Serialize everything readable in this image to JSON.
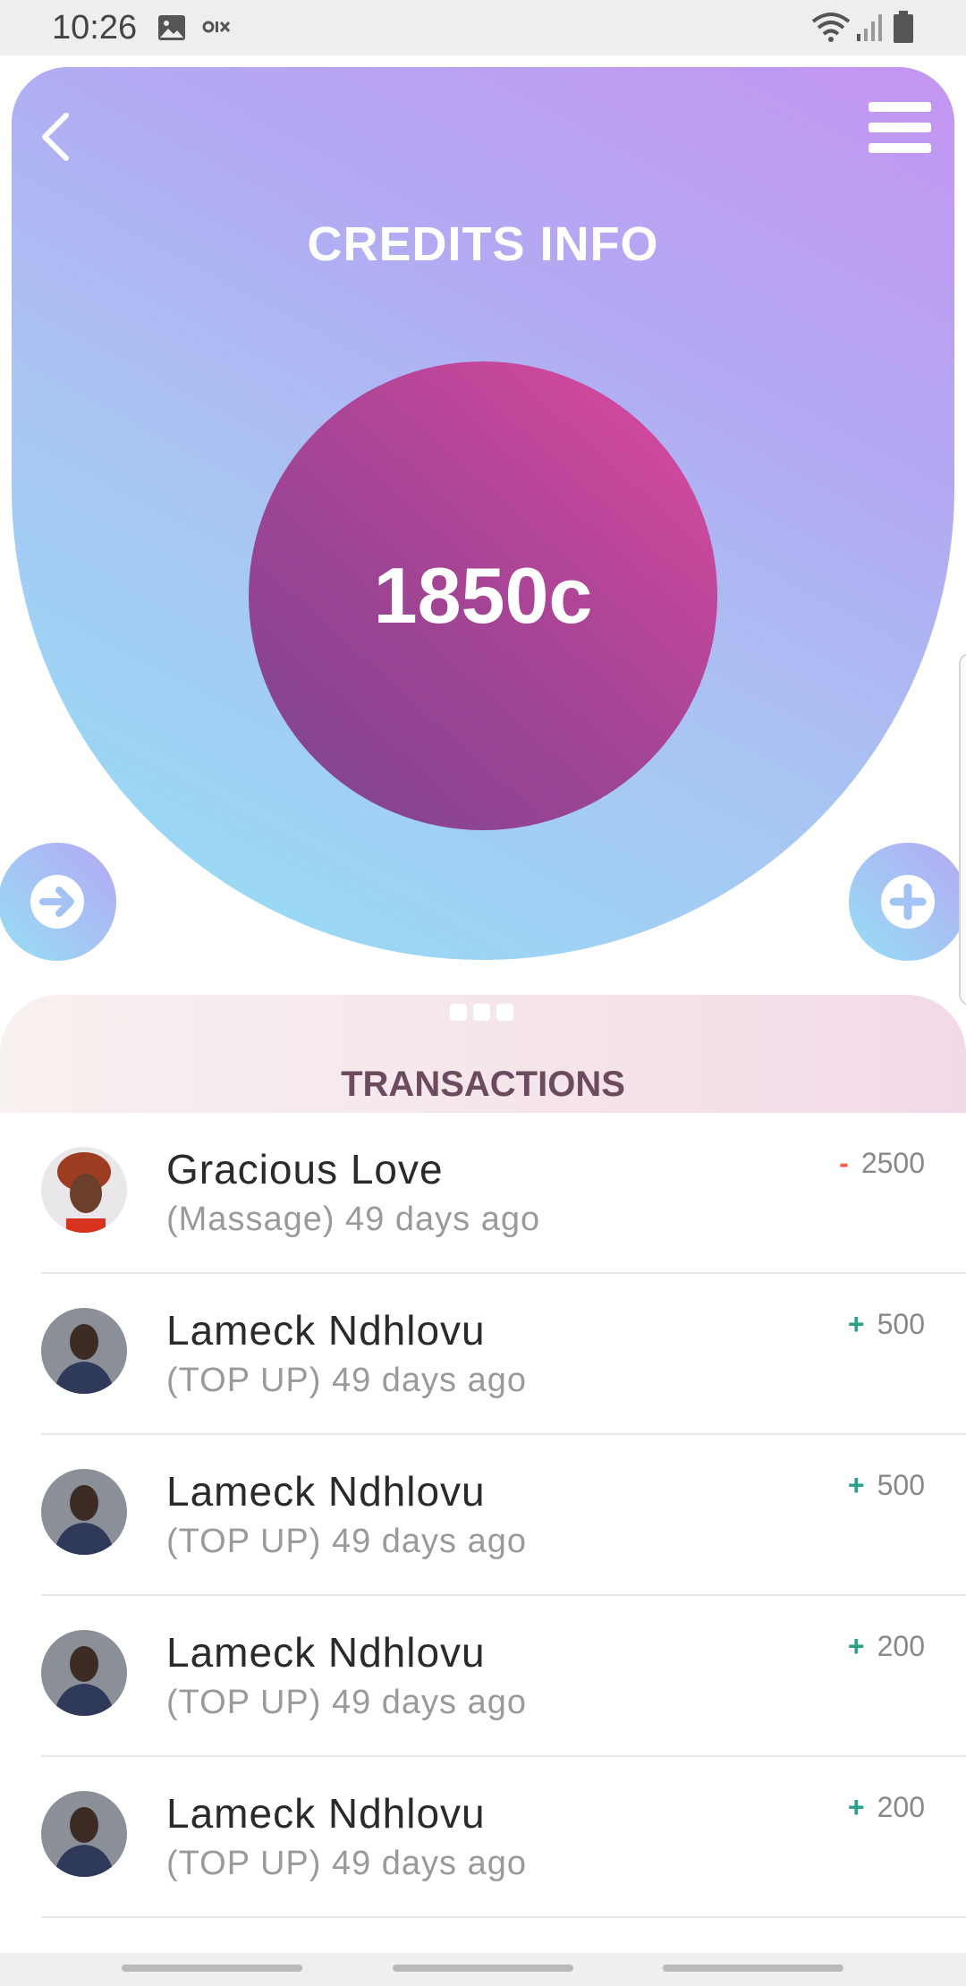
{
  "status_bar": {
    "time": "10:26",
    "icons": [
      "image-icon",
      "voicemail-icon",
      "wifi-icon",
      "signal-icon",
      "battery-icon"
    ]
  },
  "header": {
    "back_icon": "chevron-left-icon",
    "menu_icon": "hamburger-menu-icon",
    "title": "CREDITS INFO",
    "credit_balance": "1850c",
    "send_icon": "arrow-right-circle-icon",
    "add_icon": "plus-circle-icon"
  },
  "transactions": {
    "title": "TRANSACTIONS",
    "items": [
      {
        "name": "Gracious Love",
        "detail": "(Massage) 49 days ago",
        "sign": "-",
        "amount": "2500",
        "avatar": "woman-red-hair-avatar"
      },
      {
        "name": "Lameck Ndhlovu",
        "detail": "(TOP UP) 49 days ago",
        "sign": "+",
        "amount": "500",
        "avatar": "man-avatar"
      },
      {
        "name": "Lameck Ndhlovu",
        "detail": "(TOP UP) 49 days ago",
        "sign": "+",
        "amount": "500",
        "avatar": "man-avatar"
      },
      {
        "name": "Lameck Ndhlovu",
        "detail": "(TOP UP) 49 days ago",
        "sign": "+",
        "amount": "200",
        "avatar": "man-avatar"
      },
      {
        "name": "Lameck Ndhlovu",
        "detail": "(TOP UP) 49 days ago",
        "sign": "+",
        "amount": "200",
        "avatar": "man-avatar"
      }
    ]
  },
  "colors": {
    "header_gradient_start": "#93e1f5",
    "header_gradient_end": "#c495f2",
    "circle_gradient_start": "#7a4590",
    "circle_gradient_end": "#de4aa0",
    "debit_sign": "#ff5a4a",
    "credit_sign": "#2aa08a"
  }
}
